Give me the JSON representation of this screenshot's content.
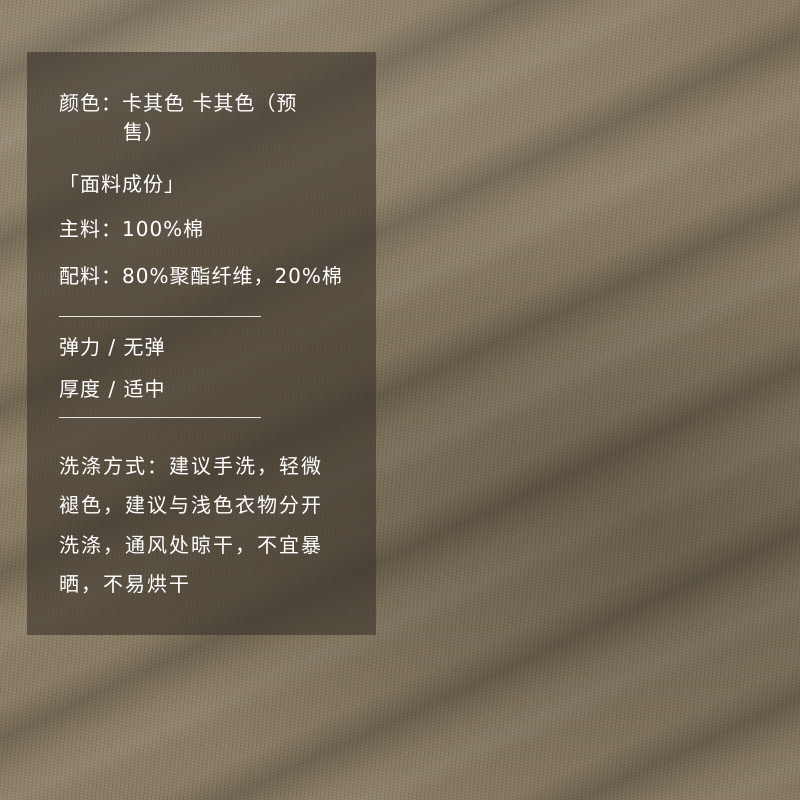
{
  "colors": {
    "fabric": "#8a7c63",
    "panel": "rgba(58,52,44,0.62)",
    "text": "#ffffff"
  },
  "info": {
    "color_label": "颜色：",
    "color_value_line1": "卡其色 卡其色（预",
    "color_value_line2": "售）",
    "composition_heading": "「面料成份」",
    "main_material": "主料：100%棉",
    "lining_material": "配料：80%聚酯纤维，20%棉",
    "elasticity": "弹力 /  无弹",
    "thickness": "厚度 /  适中",
    "wash_line1": "洗涤方式：建议手洗，轻微",
    "wash_line2": "褪色，建议与浅色衣物分开",
    "wash_line3": "洗涤，通风处晾干，不宜暴",
    "wash_line4": "晒，不易烘干"
  }
}
